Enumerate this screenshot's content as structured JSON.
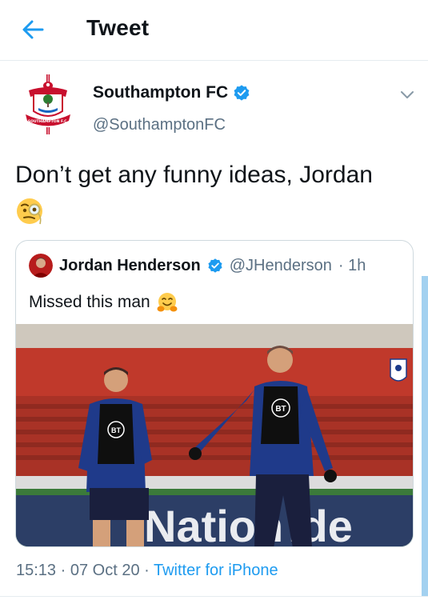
{
  "header": {
    "title": "Tweet",
    "back_icon": "back-arrow-icon"
  },
  "author": {
    "name": "Southampton FC",
    "handle": "@SouthamptonFC",
    "verified": true,
    "avatar": "southampton-crest"
  },
  "tweet": {
    "text": "Don’t get any funny ideas, Jordan",
    "emoji": "face-with-monocle"
  },
  "quoted_tweet": {
    "name": "Jordan Henderson",
    "handle": "@JHenderson",
    "time": "· 1h",
    "verified": true,
    "text": "Missed this man",
    "emoji": "hugging-face",
    "photo": {
      "banner_text": "Nation",
      "banner_text_end": "ide",
      "shirt_logo": "BT"
    }
  },
  "meta": {
    "time": "15:13",
    "date": "07 Oct 20",
    "source": "Twitter for iPhone",
    "sep1": " · ",
    "sep2": " · "
  },
  "colors": {
    "accent": "#1d9bf0",
    "secondary_text": "#5b7083",
    "border": "#cfd9de"
  }
}
